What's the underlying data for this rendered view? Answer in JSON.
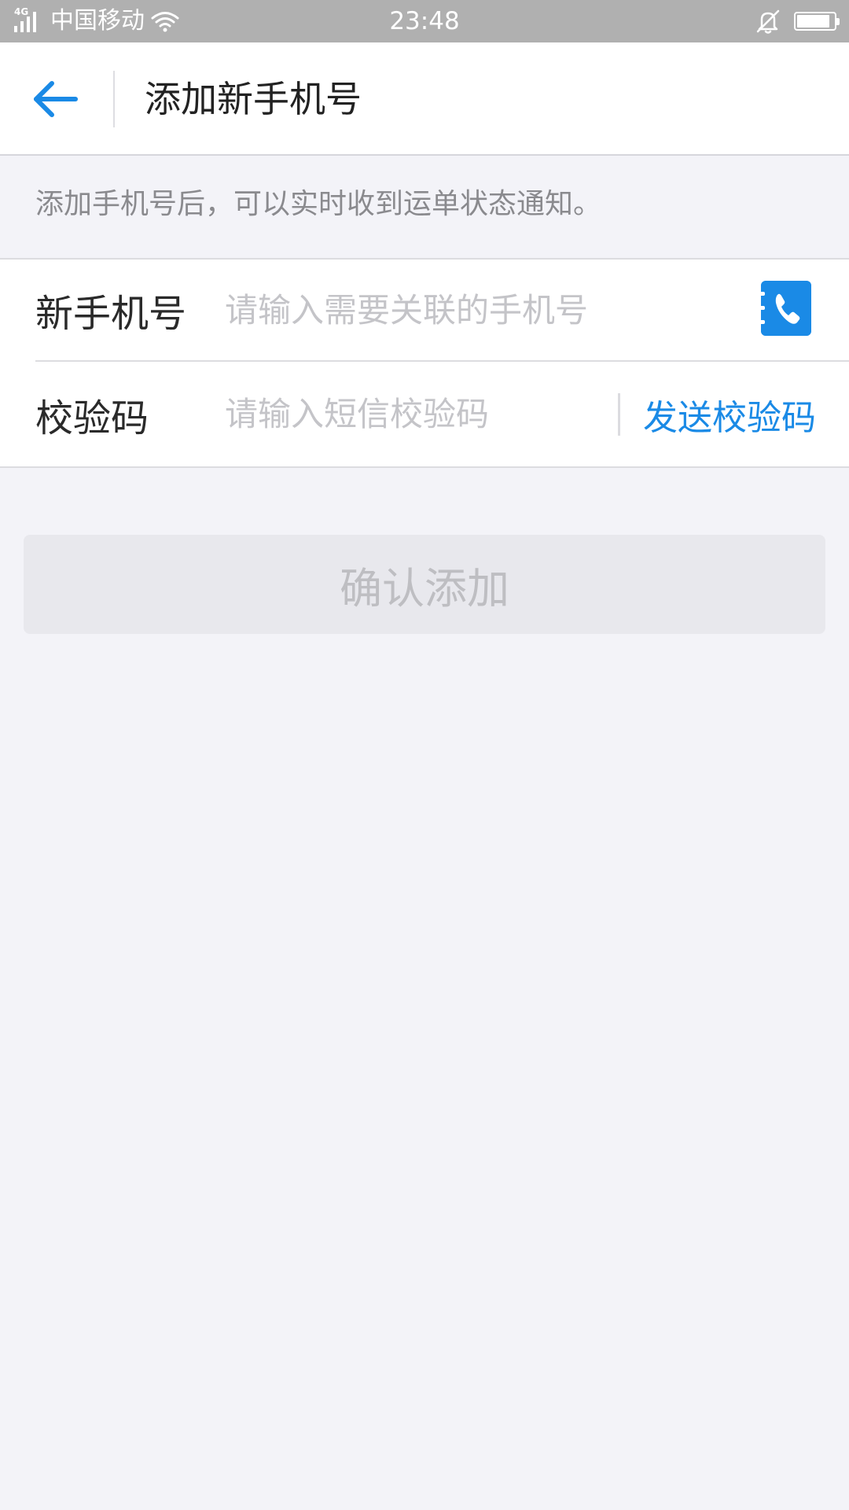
{
  "status_bar": {
    "network": "4G",
    "carrier": "中国移动",
    "time": "23:48",
    "battery_level": 0.9,
    "icons": [
      "signal-icon",
      "wifi-icon",
      "bell-off-icon",
      "battery-icon"
    ]
  },
  "nav": {
    "title": "添加新手机号",
    "back_icon": "arrow-left-icon"
  },
  "notice": "添加手机号后，可以实时收到运单状态通知。",
  "form": {
    "phone": {
      "label": "新手机号",
      "value": "",
      "placeholder": "请输入需要关联的手机号",
      "contacts_icon": "contacts-phone-icon"
    },
    "code": {
      "label": "校验码",
      "value": "",
      "placeholder": "请输入短信校验码",
      "send_label": "发送校验码"
    }
  },
  "confirm_label": "确认添加",
  "colors": {
    "accent": "#1a8ae6",
    "background": "#f3f3f8",
    "status_bar": "#b0b0b0",
    "disabled_button": "#e8e8ed",
    "disabled_text": "#bebec2"
  }
}
